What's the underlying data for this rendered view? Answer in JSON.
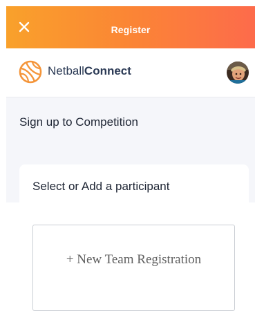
{
  "header": {
    "title": "Register",
    "close_icon": "close-icon",
    "gradient": [
      "#f9a12b",
      "#fd6b4b"
    ]
  },
  "brand": {
    "name_prefix": "Netball",
    "name_suffix": "Connect",
    "logo_icon": "netball-logo-icon",
    "logo_color": "#f4953a",
    "text_color": "#2b3a55"
  },
  "user": {
    "avatar_icon": "user-avatar"
  },
  "page": {
    "section_title": "Sign up to Competition",
    "card_title": "Select or Add a participant",
    "background": "#f5f6fa"
  },
  "actions": {
    "new_team_label": "+ New Team Registration"
  }
}
